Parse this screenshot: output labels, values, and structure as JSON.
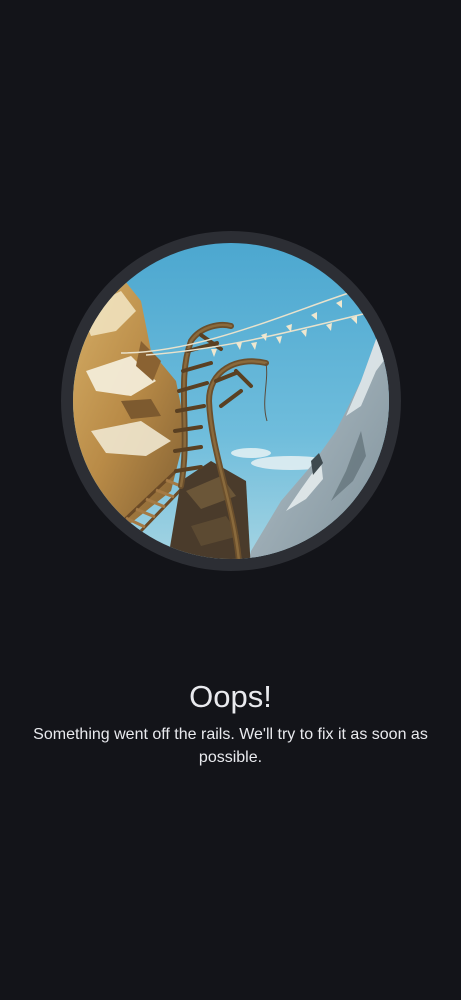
{
  "error_page": {
    "title": "Oops!",
    "message": "Something went off the rails. We'll try to fix it as soon as possible.",
    "illustration": "roller-coaster-off-rails-illustration"
  },
  "colors": {
    "background": "#131419",
    "text": "#e9eaee",
    "frame_ring": "#2c2e34"
  }
}
